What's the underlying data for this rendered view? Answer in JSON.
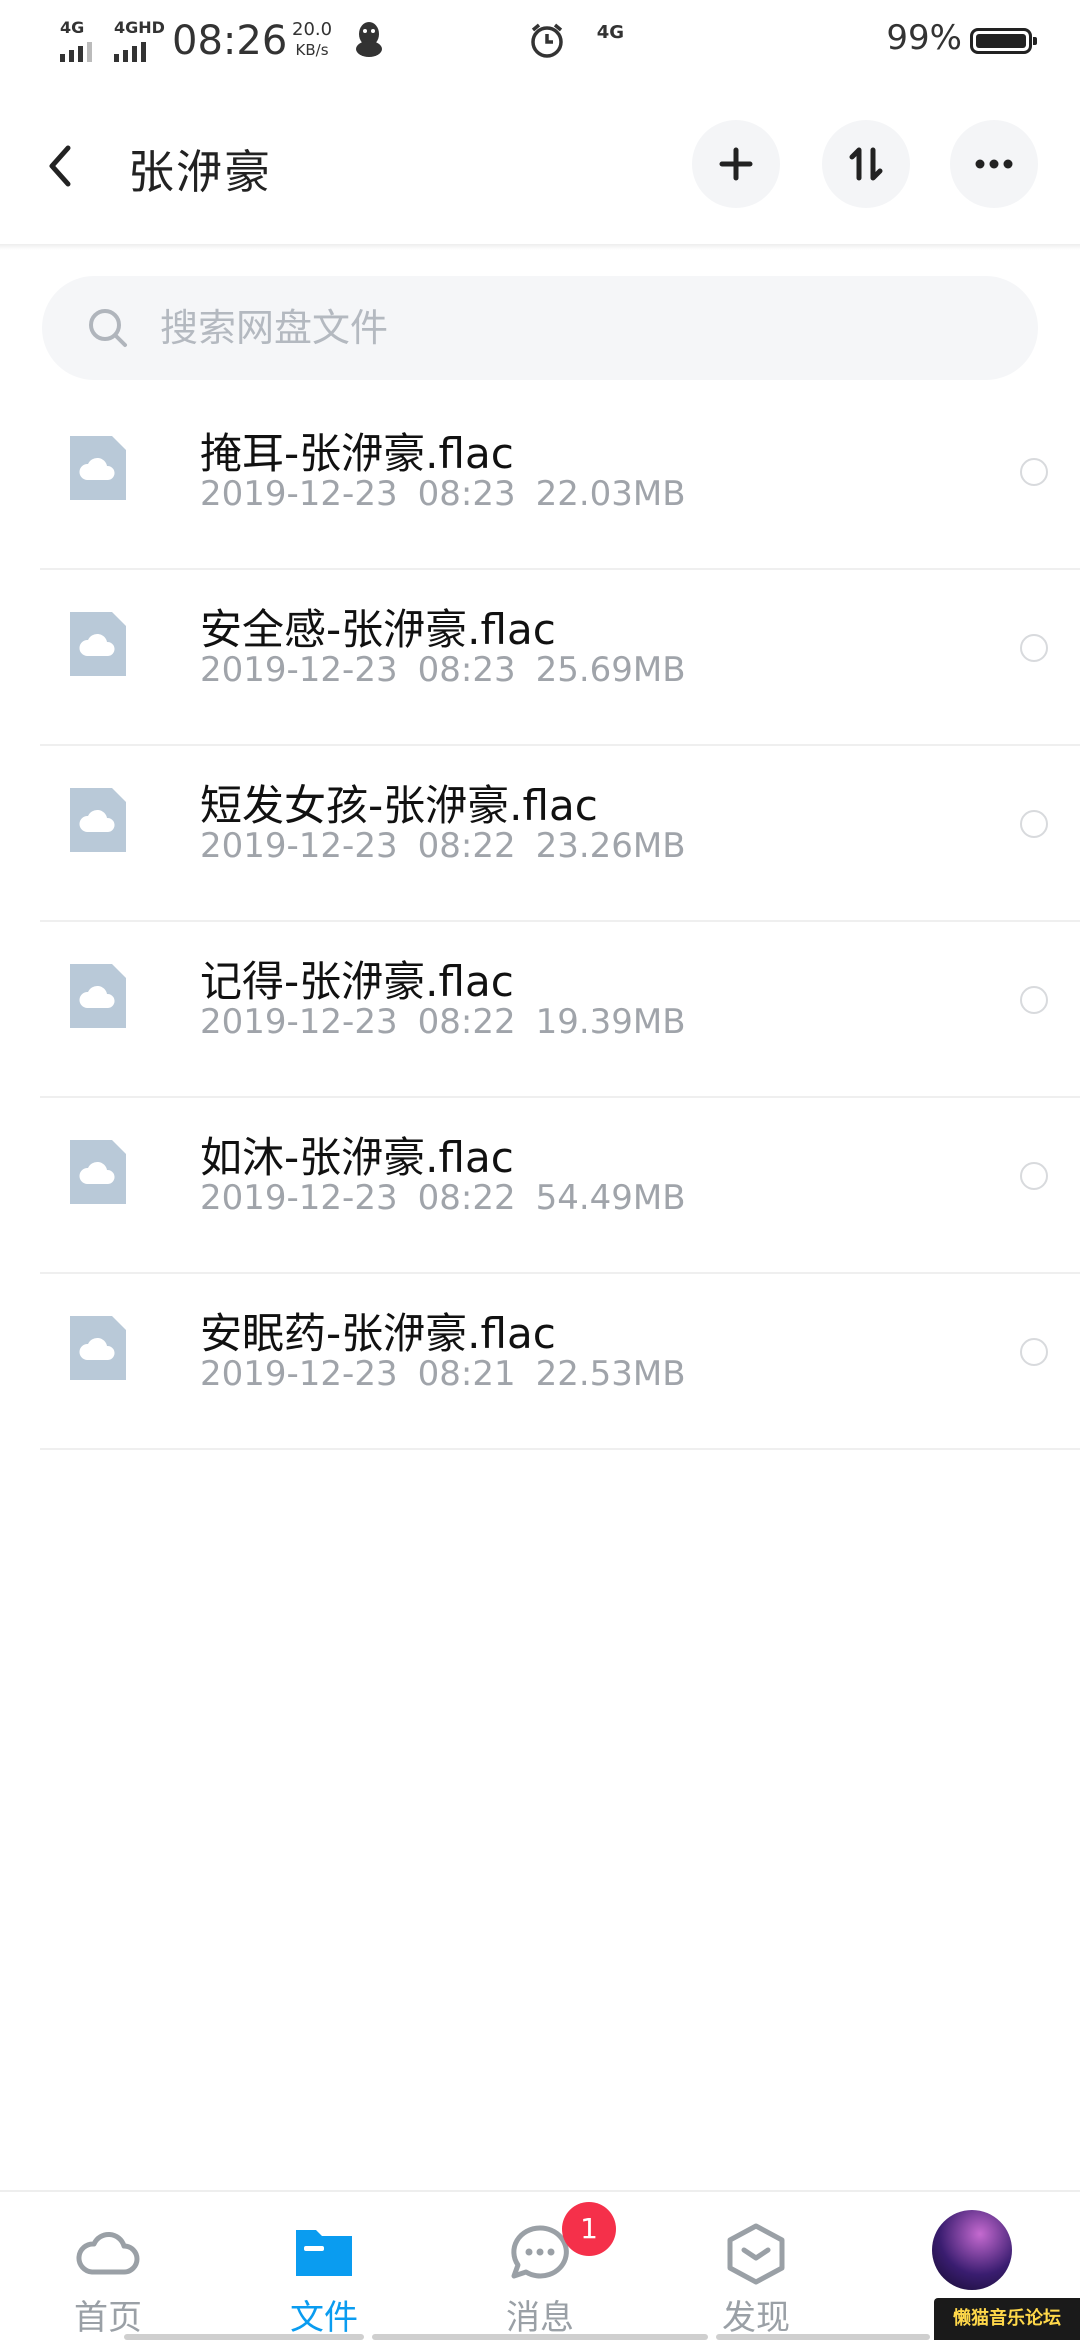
{
  "status_bar": {
    "signal1": "4G",
    "signal2": "4GHD",
    "time": "08:26",
    "speed_value": "20.0",
    "speed_unit": "KB/s",
    "network": "4G",
    "battery": "99%"
  },
  "header": {
    "title": "张洢豪",
    "back_icon": "chevron-left-icon",
    "add_icon": "plus-icon",
    "sort_icon": "sort-icon",
    "more_icon": "more-icon"
  },
  "search": {
    "placeholder": "搜索网盘文件"
  },
  "files": [
    {
      "name": "掩耳-张洢豪.flac",
      "date": "2019-12-23",
      "time": "08:23",
      "size": "22.03MB"
    },
    {
      "name": "安全感-张洢豪.flac",
      "date": "2019-12-23",
      "time": "08:23",
      "size": "25.69MB"
    },
    {
      "name": "短发女孩-张洢豪.flac",
      "date": "2019-12-23",
      "time": "08:22",
      "size": "23.26MB"
    },
    {
      "name": "记得-张洢豪.flac",
      "date": "2019-12-23",
      "time": "08:22",
      "size": "19.39MB"
    },
    {
      "name": "如沐-张洢豪.flac",
      "date": "2019-12-23",
      "time": "08:22",
      "size": "54.49MB"
    },
    {
      "name": "安眠药-张洢豪.flac",
      "date": "2019-12-23",
      "time": "08:21",
      "size": "22.53MB"
    }
  ],
  "bottom_nav": {
    "items": [
      {
        "label": "首页",
        "icon": "cloud-icon"
      },
      {
        "label": "文件",
        "icon": "folder-icon"
      },
      {
        "label": "消息",
        "icon": "chat-icon",
        "badge": "1"
      },
      {
        "label": "发现",
        "icon": "discover-icon"
      }
    ]
  },
  "watermark": "懒猫音乐论坛",
  "colors": {
    "accent": "#0a9cf0",
    "badge": "#f5304a",
    "file_icon": "#b9c9d8"
  }
}
